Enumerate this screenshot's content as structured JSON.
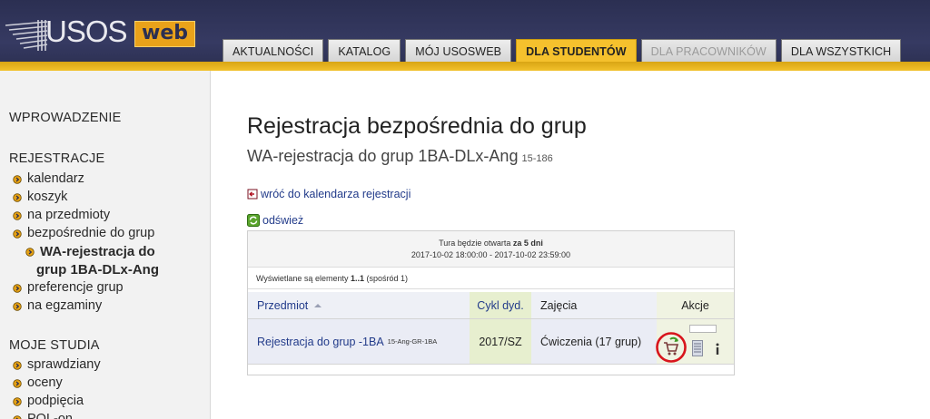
{
  "header": {
    "logo_text": "USOS",
    "logo_badge": "web",
    "tabs": [
      {
        "label": "AKTUALNOŚCI",
        "state": "normal"
      },
      {
        "label": "KATALOG",
        "state": "normal"
      },
      {
        "label": "MÓJ USOSWEB",
        "state": "normal"
      },
      {
        "label": "DLA STUDENTÓW",
        "state": "active"
      },
      {
        "label": "DLA PRACOWNIKÓW",
        "state": "disabled"
      },
      {
        "label": "DLA WSZYSTKICH",
        "state": "normal"
      }
    ]
  },
  "sidebar": {
    "section_intro": "WPROWADZENIE",
    "section_registrations": "REJESTRACJE",
    "registrations": [
      "kalendarz",
      "koszyk",
      "na przedmioty",
      "bezpośrednie do grup"
    ],
    "current_line1": "WA-rejestracja do",
    "current_line2": "grup 1BA-DLx-Ang",
    "registrations_after": [
      "preferencje grup",
      "na egzaminy"
    ],
    "section_studies": "MOJE STUDIA",
    "studies": [
      "sprawdziany",
      "oceny",
      "podpięcia",
      "POL-on"
    ]
  },
  "main": {
    "title": "Rejestracja bezpośrednia do grup",
    "subtitle": "WA-rejestracja do grup 1BA-DLx-Ang",
    "subtitle_code": "15-186",
    "back_link": "wróć do kalendarza rejestracji",
    "refresh_link": "odśwież",
    "round_prefix": "Tura będzie otwarta",
    "round_bold": "za 5 dni",
    "round_dates": "2017-10-02 18:00:00  -  2017-10-02 23:59:00",
    "shown_prefix": "Wyświetlane są elementy",
    "shown_range": "1..1",
    "shown_suffix": "(spośród 1)",
    "columns": {
      "subject": "Przedmiot",
      "cycle": "Cykl dyd.",
      "classes": "Zajęcia",
      "actions": "Akcje"
    },
    "row": {
      "subject": "Rejestracja do grup -1BA",
      "subject_code": "15-Ang-GR-1BA",
      "cycle": "2017/SZ",
      "classes": "Ćwiczenia (17 grup)"
    },
    "colors": {
      "highlight_circle": "#d8141c",
      "link": "#223b8a",
      "accent": "#f5c12d"
    }
  }
}
